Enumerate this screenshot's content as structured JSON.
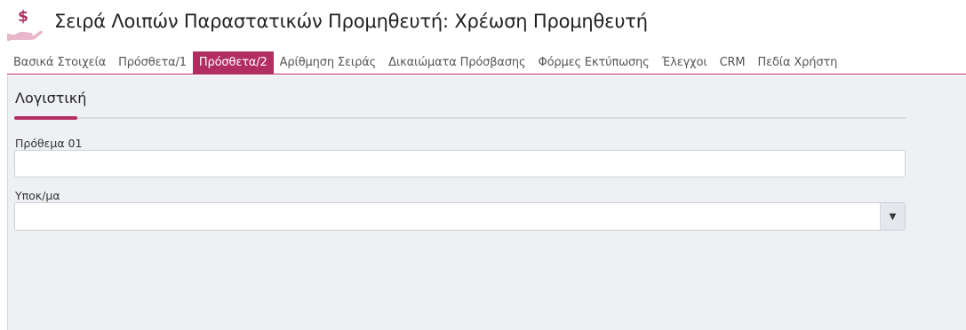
{
  "header": {
    "title": "Σειρά Λοιπών Παραστατικών Προμηθευτή: Χρέωση Προμηθευτή",
    "icon": "hand-dollar-icon",
    "icon_color": "#b22e62"
  },
  "tabs": [
    {
      "label": "Βασικά Στοιχεία",
      "active": false
    },
    {
      "label": "Πρόσθετα/1",
      "active": false
    },
    {
      "label": "Πρόσθετα/2",
      "active": true
    },
    {
      "label": "Αρίθμηση Σειράς",
      "active": false
    },
    {
      "label": "Δικαιώματα Πρόσβασης",
      "active": false
    },
    {
      "label": "Φόρμες Εκτύπωσης",
      "active": false
    },
    {
      "label": "Έλεγχοι",
      "active": false
    },
    {
      "label": "CRM",
      "active": false
    },
    {
      "label": "Πεδία Χρήστη",
      "active": false
    }
  ],
  "section": {
    "title": "Λογιστική"
  },
  "fields": {
    "prefix": {
      "label": "Πρόθεμα 01",
      "value": ""
    },
    "subledger": {
      "label": "Υποκ/μα",
      "value": "",
      "arrow": "▼"
    }
  },
  "colors": {
    "accent": "#b22e62",
    "panel_bg": "#eef0f3"
  }
}
